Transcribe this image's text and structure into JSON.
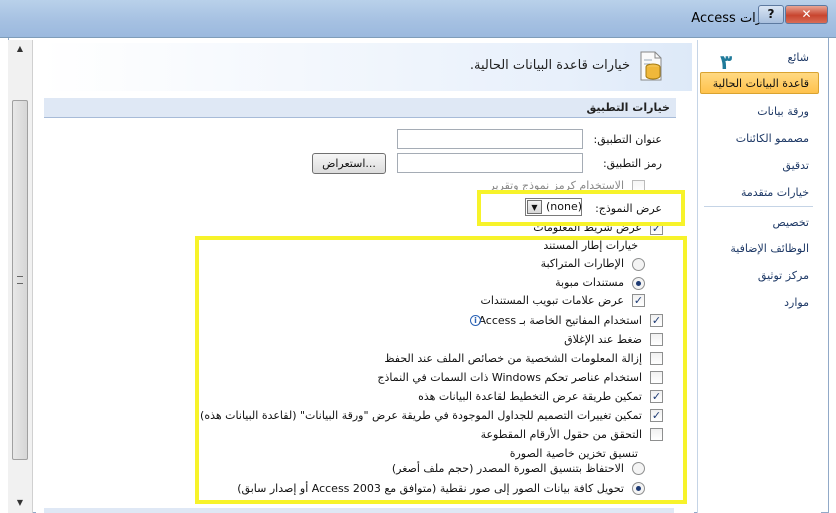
{
  "window": {
    "title": "خيارات Access",
    "help_label": "?",
    "close_label": "✕"
  },
  "nav": {
    "items": [
      {
        "label": "شائع"
      },
      {
        "label": "قاعدة البيانات الحالية",
        "active": true
      },
      {
        "label": "ورقة بيانات"
      },
      {
        "label": "مصممو الكائنات"
      },
      {
        "label": "تدقيق"
      },
      {
        "label": "خيارات متقدمة"
      },
      {
        "label": "تخصيص"
      },
      {
        "label": "الوظائف الإضافية"
      },
      {
        "label": "مركز توثيق"
      },
      {
        "label": "موارد"
      }
    ],
    "step_number": "٣"
  },
  "content": {
    "page_title": "خيارات قاعدة البيانات الحالية.",
    "section_title": "خيارات التطبيق",
    "app_title_label": "عنوان التطبيق:",
    "app_title_value": "",
    "app_icon_label": "رمز التطبيق:",
    "app_icon_value": "",
    "browse_label": "استعراض...",
    "use_as_icon_label": "الاستخدام كرمز نموذج وتقرير",
    "display_form_label": "عرض النموذج:",
    "display_form_value": "(none)",
    "status_bar_label": "عرض شريط المعلومات",
    "doc_window_header": "خيارات إطار المستند",
    "overlapping_label": "الإطارات المتراكبة",
    "tabbed_label": "مستندات مبوبة",
    "doc_tabs_label": "عرض علامات تبويب المستندات",
    "access_keys_label": "استخدام المفاتيح الخاصة بـ Access",
    "compact_label": "ضغط عند الإغلاق",
    "remove_personal_label": "إزالة المعلومات الشخصية من خصائص الملف عند الحفظ",
    "windows_themed_label": "استخدام عناصر تحكم Windows ذات السمات في النماذج",
    "layout_view_label": "تمكين طريقة عرض التخطيط لقاعدة البيانات هذه",
    "design_changes_label": "تمكين تغييرات التصميم للجداول الموجودة في طريقة عرض \"ورقة البيانات\" (لقاعدة البيانات هذه)",
    "truncated_label": "التحقق من حقول الأرقام المقطوعة",
    "picture_format_header": "تنسيق تخزين خاصية الصورة",
    "preserve_label": "الاحتفاظ بتنسيق الصورة المصدر (حجم ملف أصغر)",
    "convert_label": "تحويل كافة بيانات الصور إلى صور نقطية (متوافق مع Access 2003 أو إصدار سابق)"
  },
  "state": {
    "use_as_icon": false,
    "status_bar": true,
    "overlapping": false,
    "tabbed": true,
    "doc_tabs": true,
    "access_keys": true,
    "compact": false,
    "remove_personal": false,
    "windows_themed": false,
    "layout_view": true,
    "design_changes": true,
    "truncated": false,
    "preserve": false,
    "convert": true
  },
  "colors": {
    "highlight": "#f7f32a",
    "nav_active": "#ffc24c",
    "title_bar": "#a6c1e2"
  }
}
